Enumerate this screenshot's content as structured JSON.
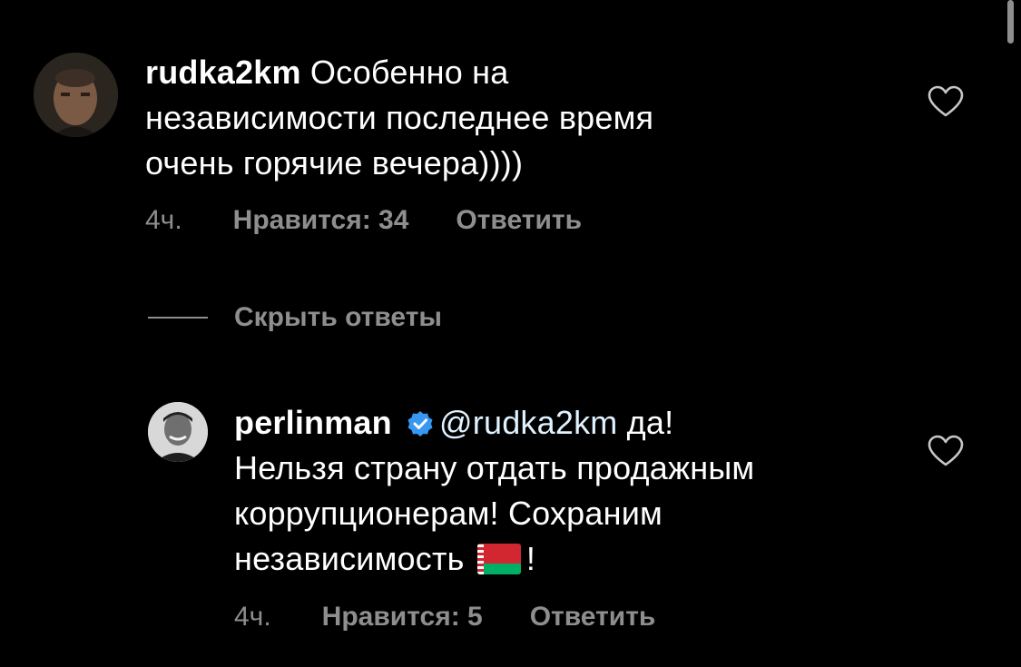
{
  "comments": [
    {
      "username": "rudka2km",
      "text_line1": " Особенно на",
      "text_line2": "независимости последнее время",
      "text_line3": "очень горячие вечера))))",
      "time": "4ч.",
      "likes_label": "Нравится: 34",
      "reply_label": "Ответить",
      "like_icon": "heart-outline-icon"
    }
  ],
  "hide_replies_label": "Скрыть ответы",
  "reply": {
    "username": "perlinman",
    "verified_icon": "verified-badge-icon",
    "mention": "@rudka2km",
    "text_line1_suffix": " да!",
    "text_line2": "Нельзя страну отдать продажным",
    "text_line3": "коррупционерам! Сохраним",
    "text_line4_prefix": "независимость",
    "text_line4_suffix": "!",
    "flag_icon": "belarus-flag-emoji",
    "time": "4ч.",
    "likes_label": "Нравится: 5",
    "reply_label": "Ответить",
    "like_icon": "heart-outline-icon"
  },
  "colors": {
    "background": "#000000",
    "text": "#ffffff",
    "muted": "#8e8e8e",
    "verified": "#3897f0"
  }
}
